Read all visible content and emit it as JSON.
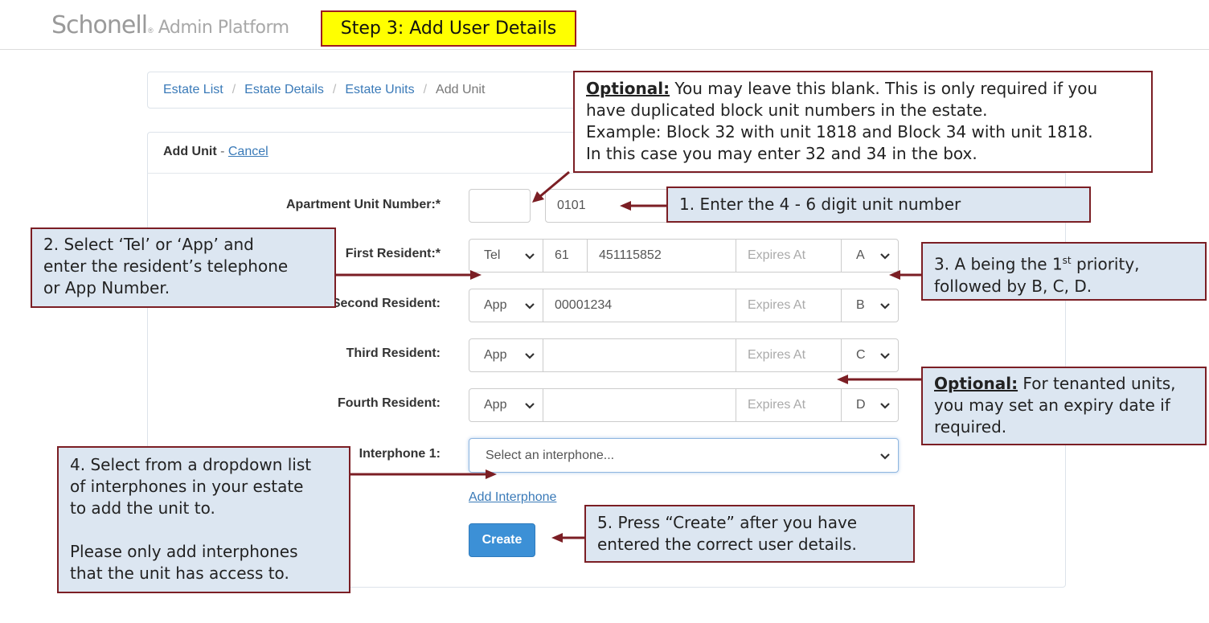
{
  "header": {
    "logo_brand": "Schonell",
    "logo_reg": "®",
    "logo_sub": "Admin Platform",
    "step_banner": "Step 3: Add User Details"
  },
  "breadcrumb": {
    "items": [
      "Estate List",
      "Estate Details",
      "Estate Units"
    ],
    "current": "Add Unit"
  },
  "form": {
    "title": "Add Unit",
    "title_sep": " - ",
    "cancel_label": "Cancel",
    "apartment_label": "Apartment Unit Number:*",
    "apartment_block_value": "",
    "apartment_unit_value": "0101",
    "residents": [
      {
        "label": "First Resident:*",
        "type": "Tel",
        "code": "61",
        "number": "451115852",
        "expires_placeholder": "Expires At",
        "priority": "A"
      },
      {
        "label": "Second Resident:",
        "type": "App",
        "number": "00001234",
        "expires_placeholder": "Expires At",
        "priority": "B"
      },
      {
        "label": "Third Resident:",
        "type": "App",
        "number": "",
        "expires_placeholder": "Expires At",
        "priority": "C"
      },
      {
        "label": "Fourth Resident:",
        "type": "App",
        "number": "",
        "expires_placeholder": "Expires At",
        "priority": "D"
      }
    ],
    "interphone_label": "Interphone 1:",
    "interphone_placeholder": "Select an interphone...",
    "add_interphone_label": "Add Interphone",
    "create_label": "Create"
  },
  "callouts": {
    "optional_block": {
      "heading": "Optional:",
      "lines": [
        " You may leave this blank. This is only required if you",
        "have duplicated block unit numbers in the estate.",
        "Example: Block 32 with unit 1818 and Block 34 with unit 1818.",
        "In this case you may enter 32 and 34 in the box."
      ]
    },
    "step1": "1. Enter the 4 - 6 digit unit number",
    "step2": [
      "2. Select ‘Tel’ or ‘App’ and",
      "enter the resident’s telephone",
      "or App Number."
    ],
    "step3": {
      "pre": "3. A being the 1",
      "sup": "st",
      "post": " priority,",
      "line2": "followed by B, C, D."
    },
    "optional_expiry": {
      "heading": "Optional:",
      "lines": [
        " For tenanted units,",
        "you may set an expiry date if",
        "required."
      ]
    },
    "step4": {
      "para1": [
        "4. Select from a dropdown list",
        "of interphones in your estate",
        "to add the unit to."
      ],
      "para2": [
        "Please only add interphones",
        "that the unit has access to."
      ]
    },
    "step5": [
      "5. Press “Create” after you have",
      "entered the correct user details."
    ]
  },
  "colors": {
    "banner_bg": "#ffff00",
    "callout_bg": "#dce6f1",
    "callout_border": "#7b1e24",
    "link": "#3a7ab8",
    "create_bg": "#3c90d6"
  }
}
